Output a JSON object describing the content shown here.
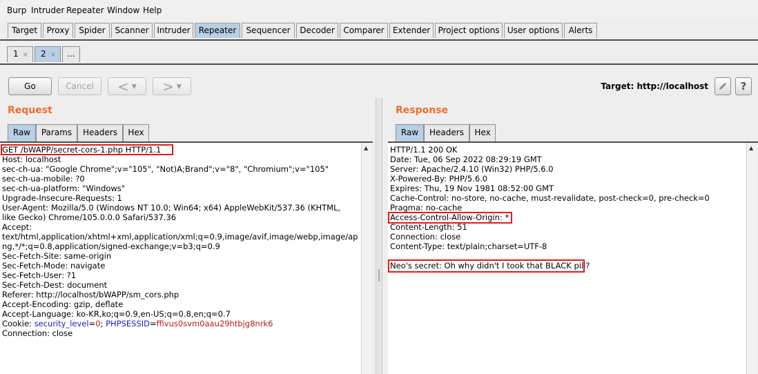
{
  "menu": [
    "Burp",
    "Intruder",
    "Repeater",
    "Window",
    "Help"
  ],
  "main_tabs": [
    "Target",
    "Proxy",
    "Spider",
    "Scanner",
    "Intruder",
    "Repeater",
    "Sequencer",
    "Decoder",
    "Comparer",
    "Extender",
    "Project options",
    "User options",
    "Alerts"
  ],
  "active_main_tab": "Repeater",
  "sub_tabs": [
    {
      "label": "1",
      "close": "×"
    },
    {
      "label": "2",
      "close": "×"
    }
  ],
  "sub_tabs_more": "...",
  "toolbar": {
    "go": "Go",
    "cancel": "Cancel",
    "back": "<",
    "forward": ">",
    "dropdown": "▼",
    "target_label": "Target: http://localhost",
    "edit_icon": "pencil-icon",
    "help_icon": "question-icon",
    "help_glyph": "?"
  },
  "request": {
    "title": "Request",
    "tabs": [
      "Raw",
      "Params",
      "Headers",
      "Hex"
    ],
    "lines": [
      "GET /bWAPP/secret-cors-1.php HTTP/1.1",
      "Host: localhost",
      "sec-ch-ua: \"Google Chrome\";v=\"105\", \"Not)A;Brand\";v=\"8\", \"Chromium\";v=\"105\"",
      "sec-ch-ua-mobile: ?0",
      "sec-ch-ua-platform: \"Windows\"",
      "Upgrade-Insecure-Requests: 1",
      "User-Agent: Mozilla/5.0 (Windows NT 10.0; Win64; x64) AppleWebKit/537.36 (KHTML,",
      "like Gecko) Chrome/105.0.0.0 Safari/537.36",
      "Accept:",
      "text/html,application/xhtml+xml,application/xml;q=0.9,image/avif,image/webp,image/ap",
      "ng,*/*;q=0.8,application/signed-exchange;v=b3;q=0.9",
      "Sec-Fetch-Site: same-origin",
      "Sec-Fetch-Mode: navigate",
      "Sec-Fetch-User: ?1",
      "Sec-Fetch-Dest: document",
      "Referer: http://localhost/bWAPP/sm_cors.php",
      "Accept-Encoding: gzip, deflate",
      "Accept-Language: ko-KR,ko;q=0.9,en-US;q=0.8,en;q=0.7"
    ],
    "cookie": {
      "prefix": "Cookie: ",
      "k1": "security_level",
      "eq1": "=",
      "v1": "0",
      "sep": "; ",
      "k2": "PHPSESSID",
      "eq2": "=",
      "v2": "ffivus0svm0aau29htbjg8nrk6"
    },
    "last_line": "Connection: close"
  },
  "response": {
    "title": "Response",
    "tabs": [
      "Raw",
      "Headers",
      "Hex"
    ],
    "lines": [
      "HTTP/1.1 200 OK",
      "Date: Tue, 06 Sep 2022 08:29:19 GMT",
      "Server: Apache/2.4.10 (Win32) PHP/5.6.0",
      "X-Powered-By: PHP/5.6.0",
      "Expires: Thu, 19 Nov 1981 08:52:00 GMT",
      "Cache-Control: no-store, no-cache, must-revalidate, post-check=0, pre-check=0",
      "Pragma: no-cache",
      "Access-Control-Allow-Origin: *",
      "Content-Length: 51",
      "Connection: close",
      "Content-Type: text/plain;charset=UTF-8",
      "",
      "Neo's secret: Oh why didn't I took that BLACK pill?"
    ]
  },
  "colors": {
    "accent": "#f06e2c",
    "highlight": "#e11b1b",
    "active_tab": "#b8cfe5"
  }
}
